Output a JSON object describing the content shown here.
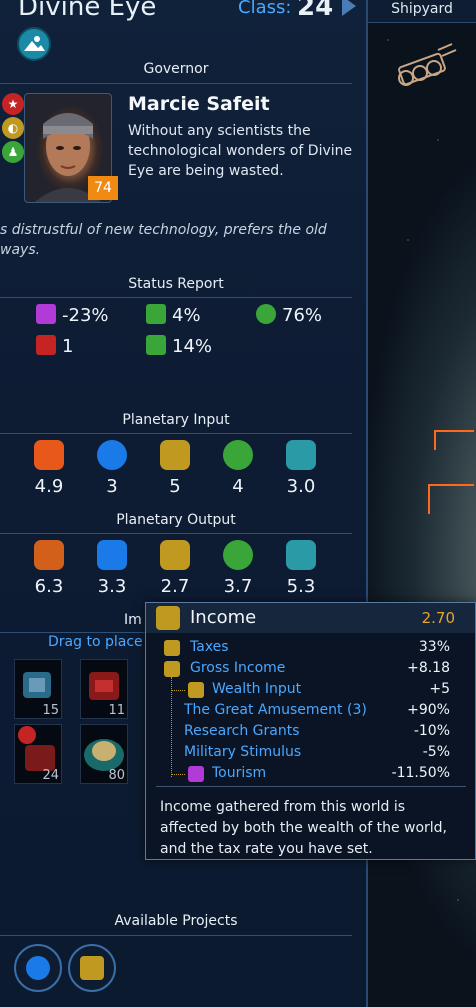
{
  "header": {
    "title": "Divine Eye",
    "class_label": "Class:",
    "class_value": "24"
  },
  "shipyard": {
    "label": "Shipyard"
  },
  "governor": {
    "section_title": "Governor",
    "name": "Marcie Safeit",
    "description": "Without any scientists the technological wonders of Divine Eye are being wasted.",
    "level": "74",
    "trait": "s distrustful of new technology, prefers the old ways."
  },
  "status_report": {
    "title": "Status Report",
    "items": [
      {
        "icon": "tourism-icon",
        "value": "-23%",
        "color": "#b23ad6"
      },
      {
        "icon": "biohazard-icon",
        "value": "4%",
        "color": "#3aa63a"
      },
      {
        "icon": "happiness-icon",
        "value": "76%",
        "color": "#3aa63a"
      },
      {
        "icon": "wrench-icon",
        "value": "1",
        "color": "#c42424"
      },
      {
        "icon": "fist-icon",
        "value": "14%",
        "color": "#3aa63a"
      }
    ]
  },
  "planetary_input": {
    "title": "Planetary Input",
    "items": [
      {
        "icon": "gear-icon",
        "value": "4.9",
        "color": "#e8581a"
      },
      {
        "icon": "lightbulb-icon",
        "value": "3",
        "color": "#1a7ae8"
      },
      {
        "icon": "diamond-icon",
        "value": "5",
        "color": "#c09a20"
      },
      {
        "icon": "leaf-icon",
        "value": "4",
        "color": "#3aa63a"
      },
      {
        "icon": "flag-icon",
        "value": "3.0",
        "color": "#2a9aa6"
      }
    ]
  },
  "planetary_output": {
    "title": "Planetary Output",
    "items": [
      {
        "icon": "hammer-icon",
        "value": "6.3",
        "color": "#d2601a"
      },
      {
        "icon": "flask-icon",
        "value": "3.3",
        "color": "#1a7ae8"
      },
      {
        "icon": "coin-icon",
        "value": "2.7",
        "color": "#c09a20"
      },
      {
        "icon": "apple-icon",
        "value": "3.7",
        "color": "#3aa63a"
      },
      {
        "icon": "flag-icon",
        "value": "5.3",
        "color": "#2a9aa6"
      }
    ]
  },
  "improvements": {
    "title_partial": "Im",
    "drag_label": "Drag to place",
    "projects": [
      {
        "name": "refinery",
        "count": "15"
      },
      {
        "name": "red-factory",
        "count": "11"
      },
      {
        "name": "war-factory",
        "count": "24"
      },
      {
        "name": "dome",
        "count": "80"
      }
    ]
  },
  "tooltip": {
    "title": "Income",
    "value": "2.70",
    "rows": [
      {
        "label": "Taxes",
        "value": "33%"
      },
      {
        "label": "Gross Income",
        "value": "+8.18"
      },
      {
        "label": "Wealth Input",
        "value": "+5"
      },
      {
        "label": "The Great Amusement (3)",
        "value": "+90%"
      },
      {
        "label": "Research Grants",
        "value": "-10%"
      },
      {
        "label": "Military Stimulus",
        "value": "-5%"
      },
      {
        "label": "Tourism",
        "value": "-11.50%"
      }
    ],
    "description": "Income gathered from this world is affected by both the wealth of the world, and the tax rate you have set."
  },
  "available_projects": {
    "title": "Available Projects"
  }
}
